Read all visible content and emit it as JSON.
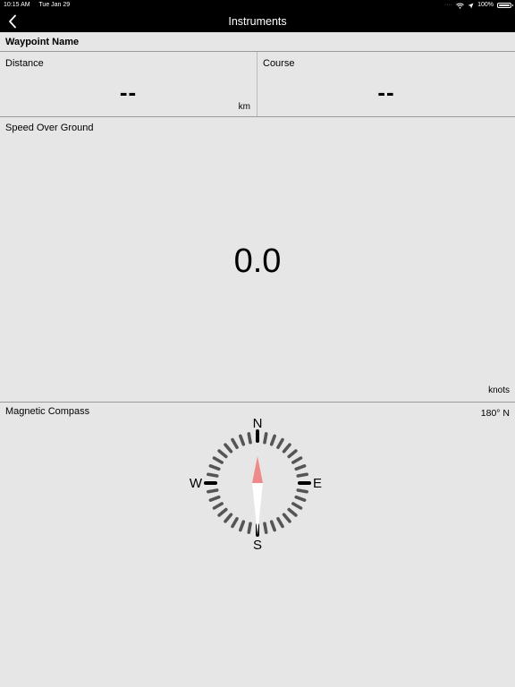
{
  "status_bar": {
    "time": "10:15 AM",
    "date": "Tue Jan 29",
    "battery": "100%"
  },
  "nav": {
    "title": "Instruments",
    "back_icon": "chevron-left-icon"
  },
  "waypoint": {
    "label": "Waypoint Name"
  },
  "distance": {
    "label": "Distance",
    "value": "--",
    "unit": "km"
  },
  "course": {
    "label": "Course",
    "value": "--"
  },
  "speed_over_ground": {
    "label": "Speed Over Ground",
    "value": "0.0",
    "unit": "knots"
  },
  "compass": {
    "label": "Magnetic Compass",
    "heading_readout": "180° N",
    "north": "N",
    "east": "E",
    "south": "S",
    "west": "W",
    "needle_north_color": "#f08a8a",
    "needle_south_color": "#ffffff",
    "tick_color": "#555555",
    "cardinal_tick_color": "#000000"
  }
}
